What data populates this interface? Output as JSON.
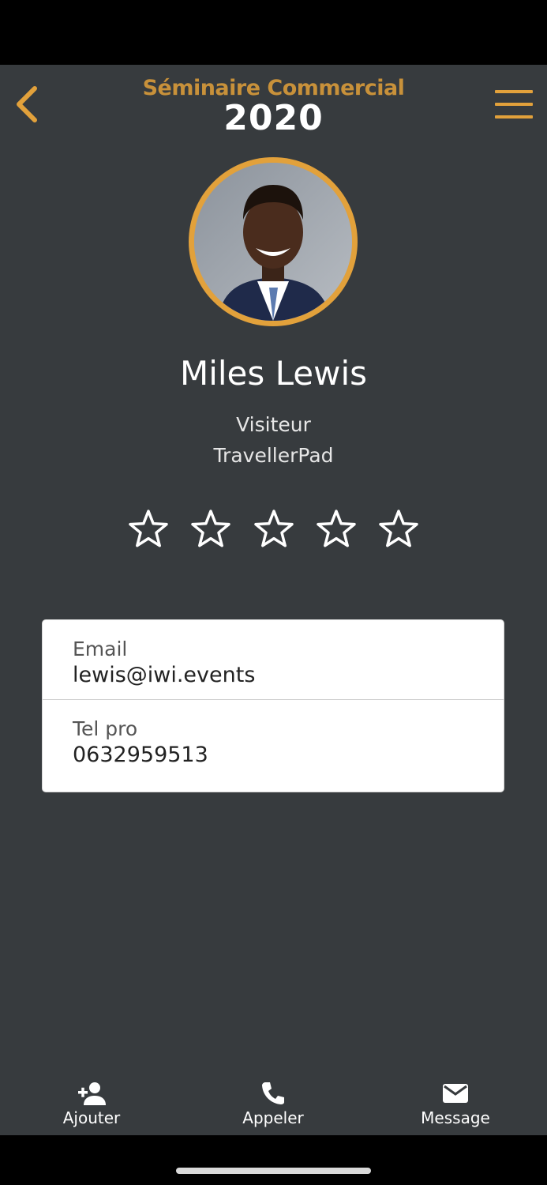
{
  "header": {
    "logo_line1": "Séminaire Commercial",
    "logo_line2": "2020",
    "back_icon": "chevron-left-icon",
    "menu_icon": "hamburger-menu-icon",
    "accent_color": "#e2a13b"
  },
  "profile": {
    "name": "Miles Lewis",
    "role": "Visiteur",
    "company": "TravellerPad",
    "rating": 0,
    "rating_max": 5
  },
  "contact": {
    "email_label": "Email",
    "email_value": "lewis@iwi.events",
    "phone_label": "Tel pro",
    "phone_value": "0632959513"
  },
  "bottom_nav": {
    "add_label": "Ajouter",
    "add_icon": "person-add-icon",
    "call_label": "Appeler",
    "call_icon": "phone-icon",
    "message_label": "Message",
    "message_icon": "envelope-icon"
  },
  "colors": {
    "background": "#373b3e",
    "card": "#ffffff",
    "accent": "#e2a13b"
  }
}
